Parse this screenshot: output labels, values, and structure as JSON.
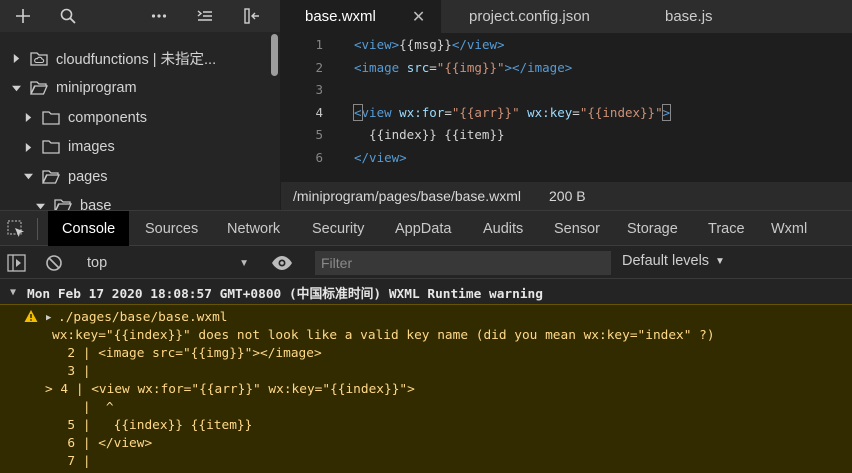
{
  "explorer": {
    "toolbar": {
      "add_icon": "plus-icon",
      "search_icon": "search-icon",
      "more_icon": "more-horizontal-icon",
      "sort_icon": "sort-icon",
      "collapse_icon": "collapse-panel-icon"
    },
    "tree": [
      {
        "label": "cloudfunctions | 未指定...",
        "expanded": false,
        "depth": 0,
        "icon": "cloud-folder-icon"
      },
      {
        "label": "miniprogram",
        "expanded": true,
        "depth": 0,
        "icon": "folder-open-icon"
      },
      {
        "label": "components",
        "expanded": false,
        "depth": 1,
        "icon": "folder-icon"
      },
      {
        "label": "images",
        "expanded": false,
        "depth": 1,
        "icon": "folder-icon"
      },
      {
        "label": "pages",
        "expanded": true,
        "depth": 1,
        "icon": "folder-open-icon"
      },
      {
        "label": "base",
        "expanded": true,
        "depth": 2,
        "icon": "folder-open-icon"
      }
    ]
  },
  "editor": {
    "tabs": [
      {
        "label": "base.wxml",
        "active": true
      },
      {
        "label": "project.config.json",
        "active": false
      },
      {
        "label": "base.js",
        "active": false
      }
    ],
    "close_glyph": "✕",
    "lines": [
      {
        "n": "1",
        "segments": [
          [
            "tag",
            "<view>"
          ],
          [
            "txt",
            "{{msg}}"
          ],
          [
            "tag",
            "</view>"
          ]
        ]
      },
      {
        "n": "2",
        "segments": [
          [
            "tag",
            "<image "
          ],
          [
            "attr",
            "src"
          ],
          [
            "txt",
            "="
          ],
          [
            "str",
            "\"{{img}}\""
          ],
          [
            "tag",
            "></image>"
          ]
        ]
      },
      {
        "n": "3",
        "segments": []
      },
      {
        "n": "4",
        "segments": [
          [
            "brk",
            "<"
          ],
          [
            "tag",
            "view "
          ],
          [
            "attr",
            "wx:for"
          ],
          [
            "txt",
            "="
          ],
          [
            "str",
            "\"{{arr}}\""
          ],
          [
            "txt",
            " "
          ],
          [
            "attr",
            "wx:key"
          ],
          [
            "txt",
            "="
          ],
          [
            "str",
            "\"{{index}}\""
          ],
          [
            "brk",
            ">"
          ]
        ],
        "current": true
      },
      {
        "n": "5",
        "segments": [
          [
            "txt",
            "  {{index}} {{item}}"
          ]
        ]
      },
      {
        "n": "6",
        "segments": [
          [
            "tag",
            "</view>"
          ]
        ]
      }
    ],
    "status": {
      "path": "/miniprogram/pages/base/base.wxml",
      "size": "200 B"
    }
  },
  "devtools": {
    "tabs": [
      {
        "label": "Console",
        "active": true
      },
      {
        "label": "Sources"
      },
      {
        "label": "Network"
      },
      {
        "label": "Security"
      },
      {
        "label": "AppData"
      },
      {
        "label": "Audits"
      },
      {
        "label": "Sensor"
      },
      {
        "label": "Storage"
      },
      {
        "label": "Trace"
      },
      {
        "label": "Wxml"
      }
    ],
    "toolbar": {
      "context": "top",
      "filter_placeholder": "Filter",
      "levels": "Default levels"
    },
    "console": {
      "group_title": "Mon Feb 17 2020 18:08:57 GMT+0800 (中国标准时间) WXML Runtime warning",
      "warning_lines": [
        "./pages/base/base.wxml",
        "wx:key=\"{{index}}\" does not look like a valid key name (did you mean wx:key=\"index\" ?)",
        "  2 | <image src=\"{{img}}\"></image>",
        "  3 |",
        "> 4 | <view wx:for=\"{{arr}}\" wx:key=\"{{index}}\">",
        "    |  ^",
        "  5 |   {{index}} {{item}}",
        "  6 | </view>",
        "  7 |"
      ]
    }
  },
  "colors": {
    "warning_bg": "#332b00",
    "warning_text": "#ffd98a",
    "tag": "#569cd6",
    "attr": "#9cdcfe",
    "string": "#ce9178"
  }
}
